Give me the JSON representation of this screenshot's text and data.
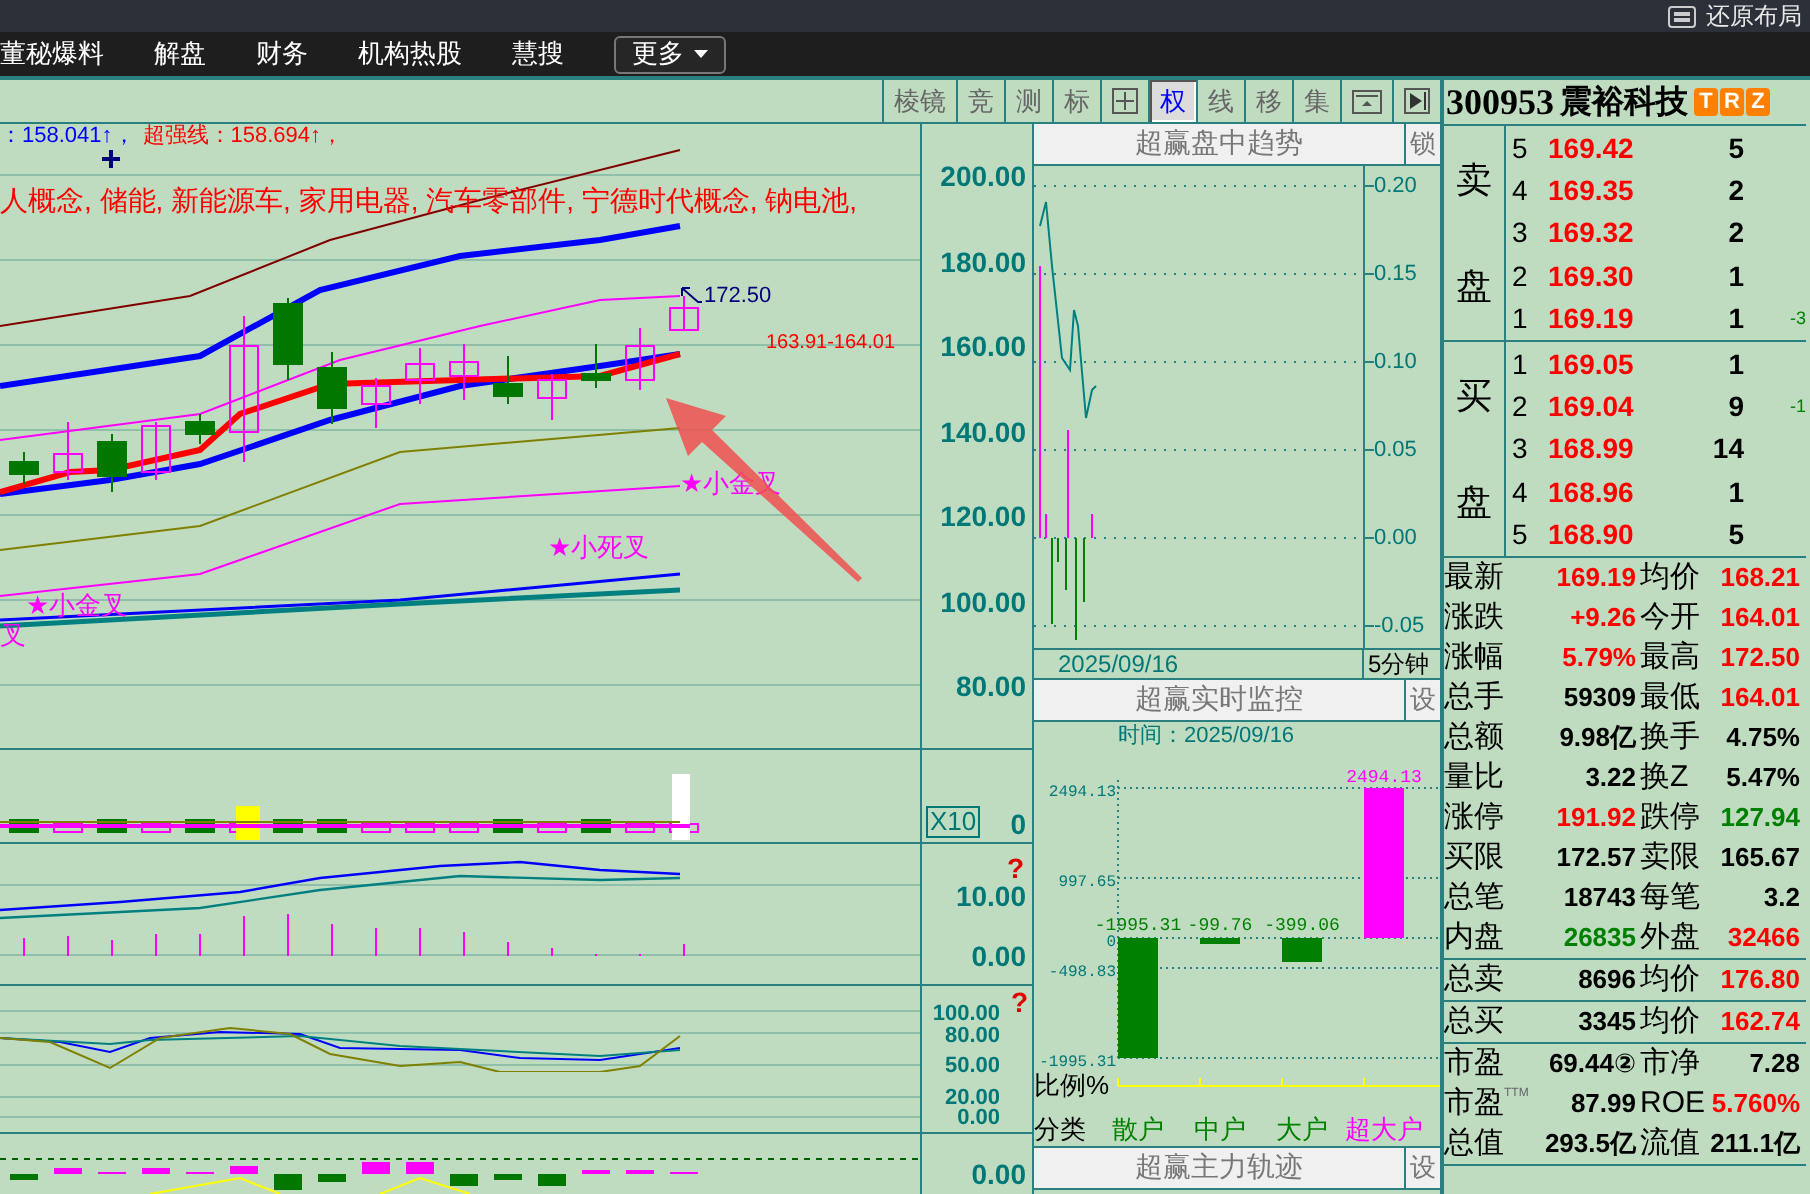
{
  "top_bar": {
    "restore_layout": "还原布局"
  },
  "menu": {
    "items": [
      {
        "label": "董秘爆料"
      },
      {
        "label": "解盘"
      },
      {
        "label": "财务"
      },
      {
        "label": "机构热股"
      },
      {
        "label": "慧搜"
      }
    ],
    "more": "更多"
  },
  "toolbar": {
    "buttons": [
      {
        "kind": "label",
        "label": "棱镜",
        "selected": false
      },
      {
        "kind": "label",
        "label": "竞",
        "selected": false
      },
      {
        "kind": "label",
        "label": "测",
        "selected": false
      },
      {
        "kind": "label",
        "label": "标",
        "selected": false
      },
      {
        "kind": "grid",
        "selected": false
      },
      {
        "kind": "label",
        "label": "权",
        "selected": true
      },
      {
        "kind": "label",
        "label": "线",
        "selected": false
      },
      {
        "kind": "label",
        "label": "移",
        "selected": false
      },
      {
        "kind": "label",
        "label": "集",
        "selected": false
      },
      {
        "kind": "panel",
        "selected": false
      },
      {
        "kind": "next",
        "selected": false
      }
    ]
  },
  "kline": {
    "indicators": [
      {
        "text": "：158.041↑，",
        "color": "#0000ff"
      },
      {
        "text": "超强线：158.694↑，",
        "color": "#ff0000"
      }
    ],
    "concepts": "人概念, 储能, 新能源车, 家用电器, 汽车零部件, 宁德时代概念, 钠电池,",
    "price_axis": [
      "200.00",
      "180.00",
      "160.00",
      "140.00",
      "120.00",
      "100.00",
      "80.00"
    ],
    "annotations": [
      {
        "kind": "high",
        "text": "172.50"
      },
      {
        "kind": "range",
        "text": "163.91-164.01"
      },
      {
        "kind": "signal",
        "text": "★小金叉"
      },
      {
        "kind": "signal",
        "text": "★小死叉"
      },
      {
        "kind": "signal",
        "text": "★小金叉"
      },
      {
        "kind": "signal",
        "text": "叉"
      }
    ]
  },
  "volume": {
    "scale_button": "X10",
    "axis": [
      "0"
    ]
  },
  "macd": {
    "axis": [
      "10.00",
      "0.00"
    ],
    "help": "?"
  },
  "kdj": {
    "axis": [
      "100.00",
      "80.00",
      "50.00",
      "20.00",
      "0.00"
    ],
    "help": "?"
  },
  "bottom_indicator": {
    "axis": [
      "0.00"
    ]
  },
  "trend": {
    "title": "超赢盘中趋势",
    "lock_button": "锁",
    "axis": [
      "0.20",
      "0.15",
      "0.10",
      "0.05",
      "0.00",
      "-0.05"
    ],
    "date": "2025/09/16",
    "period": "5分钟"
  },
  "monitor": {
    "title": "超赢实时监控",
    "settings_button": "设",
    "time_label": "时间：2025/09/16",
    "ratio_label": "比例%",
    "category_label": "分类",
    "chart_data": {
      "type": "bar",
      "categories": [
        "散户",
        "中户",
        "大户",
        "超大户"
      ],
      "series": [
        {
          "color": "#008000",
          "values": [
            -1995.31,
            -99.76,
            -399.06,
            null
          ]
        },
        {
          "color": "#ff00ff",
          "values": [
            null,
            null,
            null,
            2494.13
          ]
        }
      ],
      "stacked": true,
      "data_labels": true,
      "grid": true,
      "ylim": [
        -1995.31,
        2494.13
      ],
      "yticks": [
        2494.13,
        997.65,
        0,
        -498.83,
        -1995.31
      ]
    }
  },
  "main_track": {
    "title": "超赢主力轨迹",
    "settings_button": "设"
  },
  "quote": {
    "code": "300953",
    "name": "震裕科技",
    "badges": [
      "T",
      "R",
      "Z"
    ],
    "asks": {
      "label_top": "卖",
      "label_bottom": "盘",
      "rows": [
        {
          "level": "5",
          "price": "169.42",
          "volume": "5"
        },
        {
          "level": "4",
          "price": "169.35",
          "volume": "2"
        },
        {
          "level": "3",
          "price": "169.32",
          "volume": "2"
        },
        {
          "level": "2",
          "price": "169.30",
          "volume": "1"
        },
        {
          "level": "1",
          "price": "169.19",
          "volume": "1",
          "change": "-3"
        }
      ]
    },
    "bids": {
      "label_top": "买",
      "label_bottom": "盘",
      "rows": [
        {
          "level": "1",
          "price": "169.05",
          "volume": "1"
        },
        {
          "level": "2",
          "price": "169.04",
          "volume": "9",
          "change": "-1"
        },
        {
          "level": "3",
          "price": "168.99",
          "volume": "14"
        },
        {
          "level": "4",
          "price": "168.96",
          "volume": "1"
        },
        {
          "level": "5",
          "price": "168.90",
          "volume": "5"
        }
      ]
    },
    "stats": [
      {
        "rows": [
          {
            "cells": [
              {
                "label": "最新",
                "value": "169.19",
                "color": "#ff0000"
              },
              {
                "label": "均价",
                "value": "168.21",
                "color": "#ff0000"
              }
            ]
          },
          {
            "cells": [
              {
                "label": "涨跌",
                "value": "+9.26",
                "color": "#ff0000"
              },
              {
                "label": "今开",
                "value": "164.01",
                "color": "#ff0000"
              }
            ]
          },
          {
            "cells": [
              {
                "label": "涨幅",
                "value": "5.79%",
                "color": "#ff0000"
              },
              {
                "label": "最高",
                "value": "172.50",
                "color": "#ff0000"
              }
            ]
          },
          {
            "cells": [
              {
                "label": "总手",
                "value": "59309",
                "color": "#000000"
              },
              {
                "label": "最低",
                "value": "164.01",
                "color": "#ff0000"
              }
            ]
          },
          {
            "cells": [
              {
                "label": "总额",
                "value": "9.98亿",
                "color": "#000000"
              },
              {
                "label": "换手",
                "value": "4.75%",
                "color": "#000000"
              }
            ]
          },
          {
            "cells": [
              {
                "label": "量比",
                "value": "3.22",
                "color": "#000000"
              },
              {
                "label": "换Z",
                "value": "5.47%",
                "color": "#000000"
              }
            ]
          },
          {
            "cells": [
              {
                "label": "涨停",
                "value": "191.92",
                "color": "#ff0000"
              },
              {
                "label": "跌停",
                "value": "127.94",
                "color": "#008000"
              }
            ]
          },
          {
            "cells": [
              {
                "label": "买限",
                "value": "172.57",
                "color": "#000000"
              },
              {
                "label": "卖限",
                "value": "165.67",
                "color": "#000000"
              }
            ]
          },
          {
            "cells": [
              {
                "label": "总笔",
                "value": "18743",
                "color": "#000000"
              },
              {
                "label": "每笔",
                "value": "3.2",
                "color": "#000000"
              }
            ]
          },
          {
            "cells": [
              {
                "label": "内盘",
                "value": "26835",
                "color": "#008000"
              },
              {
                "label": "外盘",
                "value": "32466",
                "color": "#ff0000"
              }
            ]
          }
        ]
      },
      {
        "rows": [
          {
            "cells": [
              {
                "label": "总卖",
                "value": "8696",
                "color": "#000000"
              },
              {
                "label": "均价",
                "value": "176.80",
                "color": "#ff0000"
              }
            ]
          }
        ]
      },
      {
        "rows": [
          {
            "cells": [
              {
                "label": "总买",
                "value": "3345",
                "color": "#000000"
              },
              {
                "label": "均价",
                "value": "162.74",
                "color": "#ff0000"
              }
            ]
          }
        ]
      },
      {
        "rows": [
          {
            "cells": [
              {
                "label": "市盈",
                "value": "69.44②",
                "color": "#000000"
              },
              {
                "label": "市净",
                "value": "7.28",
                "color": "#000000"
              }
            ]
          },
          {
            "cells": [
              {
                "label": "市盈$^{TTM}$",
                "value": "87.99",
                "color": "#000000"
              },
              {
                "label": "ROE",
                "value": "5.760%",
                "color": "#ff0000"
              }
            ]
          },
          {
            "cells": [
              {
                "label": "总值",
                "value": "293.5亿",
                "color": "#000000"
              },
              {
                "label": "流值",
                "value": "211.1亿",
                "color": "#000000"
              }
            ]
          }
        ]
      }
    ]
  }
}
